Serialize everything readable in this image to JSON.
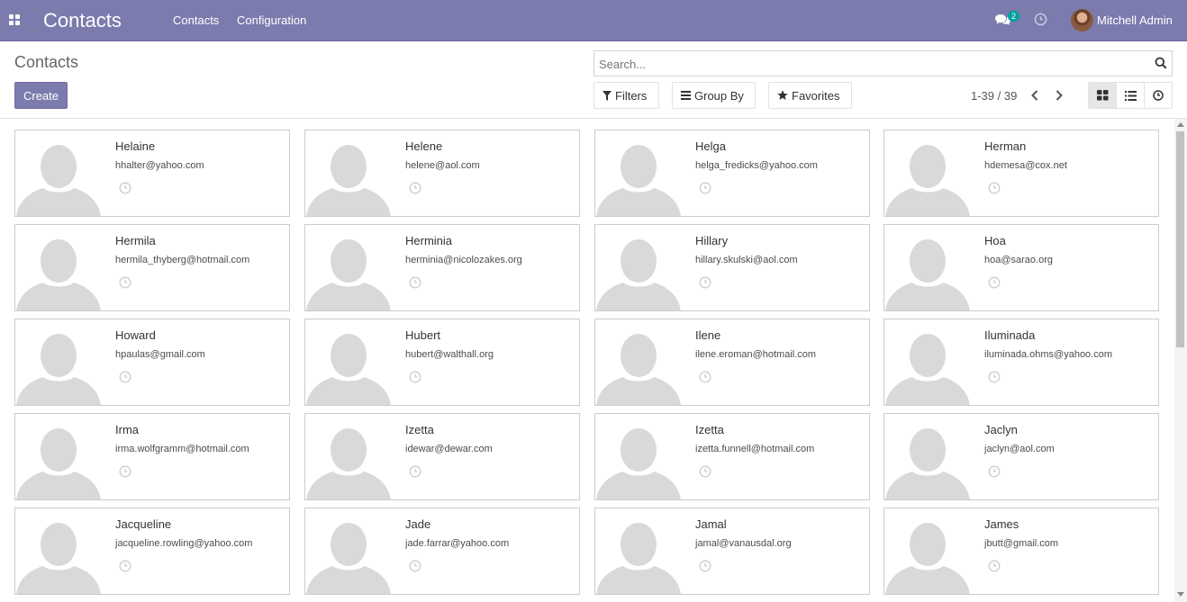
{
  "navbar": {
    "app_title": "Contacts",
    "menu": [
      "Contacts",
      "Configuration"
    ],
    "chat_count": "2",
    "user_name": "Mitchell Admin",
    "bg_color": "#7c7bad"
  },
  "control_panel": {
    "title": "Contacts",
    "create_label": "Create",
    "search_placeholder": "Search...",
    "filters_label": "Filters",
    "group_by_label": "Group By",
    "favorites_label": "Favorites",
    "pager": "1-39 / 39",
    "active_view": "kanban"
  },
  "contacts": [
    {
      "name": "Helaine",
      "email": "hhalter@yahoo.com"
    },
    {
      "name": "Helene",
      "email": "helene@aol.com"
    },
    {
      "name": "Helga",
      "email": "helga_fredicks@yahoo.com"
    },
    {
      "name": "Herman",
      "email": "hdemesa@cox.net"
    },
    {
      "name": "Hermila",
      "email": "hermila_thyberg@hotmail.com"
    },
    {
      "name": "Herminia",
      "email": "herminia@nicolozakes.org"
    },
    {
      "name": "Hillary",
      "email": "hillary.skulski@aol.com"
    },
    {
      "name": "Hoa",
      "email": "hoa@sarao.org"
    },
    {
      "name": "Howard",
      "email": "hpaulas@gmail.com"
    },
    {
      "name": "Hubert",
      "email": "hubert@walthall.org"
    },
    {
      "name": "Ilene",
      "email": "ilene.eroman@hotmail.com"
    },
    {
      "name": "Iluminada",
      "email": "iluminada.ohms@yahoo.com"
    },
    {
      "name": "Irma",
      "email": "irma.wolfgramm@hotmail.com"
    },
    {
      "name": "Izetta",
      "email": "idewar@dewar.com"
    },
    {
      "name": "Izetta",
      "email": "izetta.funnell@hotmail.com"
    },
    {
      "name": "Jaclyn",
      "email": "jaclyn@aol.com"
    },
    {
      "name": "Jacqueline",
      "email": "jacqueline.rowling@yahoo.com"
    },
    {
      "name": "Jade",
      "email": "jade.farrar@yahoo.com"
    },
    {
      "name": "Jamal",
      "email": "jamal@vanausdal.org"
    },
    {
      "name": "James",
      "email": "jbutt@gmail.com"
    }
  ]
}
